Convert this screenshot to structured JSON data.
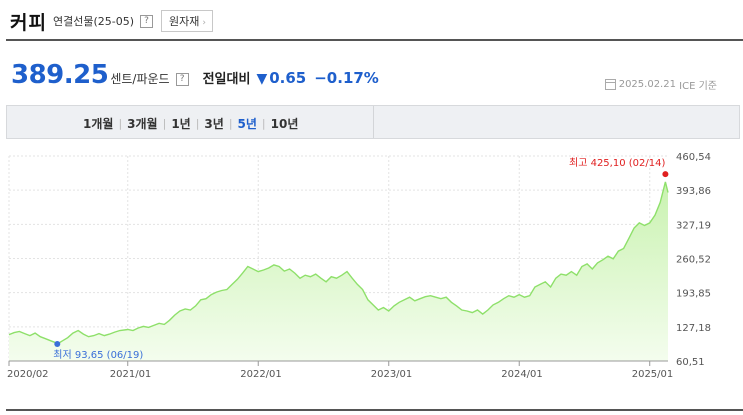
{
  "header": {
    "title": "커피",
    "subtitle": "연결선물(25-05)",
    "help": "?",
    "raw_button": "원자재",
    "raw_arrow": "›"
  },
  "quote": {
    "price": "389.25",
    "unit": "센트/파운드",
    "help": "?",
    "change_label": "전일대비",
    "change_arrow": "▼",
    "change_value": "0.65",
    "change_pct": "−0.17%",
    "date": "2025.02.21",
    "source": "ICE 기준"
  },
  "period_tabs": [
    {
      "label": "1개월",
      "active": false
    },
    {
      "label": "3개월",
      "active": false
    },
    {
      "label": "1년",
      "active": false
    },
    {
      "label": "3년",
      "active": false
    },
    {
      "label": "5년",
      "active": true
    },
    {
      "label": "10년",
      "active": false
    }
  ],
  "colors": {
    "price_blue": "#1e5fcc",
    "line_green": "#8ee06a",
    "fill_top": "#c9f2b0",
    "fill_bottom": "#f4fdee",
    "high_red": "#e02020",
    "low_blue": "#3a6fd8"
  },
  "chart_data": {
    "type": "area",
    "ylim": [
      60.51,
      460.54
    ],
    "y_ticks": [
      "460,54",
      "393,86",
      "327,19",
      "260,52",
      "193,85",
      "127,18",
      "60,51"
    ],
    "x_ticks": [
      "2020/02",
      "2021/01",
      "2022/01",
      "2023/01",
      "2024/01",
      "2025/01"
    ],
    "x_tick_dates": [
      2020.09,
      2021.0,
      2022.0,
      2023.0,
      2024.0,
      2025.0
    ],
    "x_range": [
      2020.09,
      2025.14
    ],
    "high": {
      "label": "최고 425,10 (02/14)",
      "date": 2025.12,
      "value": 425.1
    },
    "low": {
      "label": "최저 93,65 (06/19)",
      "date": 2020.46,
      "value": 93.65
    },
    "series": [
      {
        "points": [
          [
            2020.09,
            112
          ],
          [
            2020.13,
            116
          ],
          [
            2020.17,
            118
          ],
          [
            2020.21,
            114
          ],
          [
            2020.25,
            110
          ],
          [
            2020.29,
            115
          ],
          [
            2020.33,
            108
          ],
          [
            2020.37,
            104
          ],
          [
            2020.41,
            100
          ],
          [
            2020.44,
            97
          ],
          [
            2020.46,
            93.65
          ],
          [
            2020.5,
            100
          ],
          [
            2020.54,
            106
          ],
          [
            2020.58,
            115
          ],
          [
            2020.62,
            120
          ],
          [
            2020.66,
            113
          ],
          [
            2020.7,
            108
          ],
          [
            2020.74,
            110
          ],
          [
            2020.78,
            114
          ],
          [
            2020.82,
            110
          ],
          [
            2020.86,
            113
          ],
          [
            2020.9,
            117
          ],
          [
            2020.94,
            120
          ],
          [
            2021.0,
            122
          ],
          [
            2021.04,
            120
          ],
          [
            2021.08,
            125
          ],
          [
            2021.12,
            128
          ],
          [
            2021.16,
            126
          ],
          [
            2021.2,
            130
          ],
          [
            2021.24,
            134
          ],
          [
            2021.28,
            132
          ],
          [
            2021.32,
            140
          ],
          [
            2021.36,
            150
          ],
          [
            2021.4,
            158
          ],
          [
            2021.44,
            162
          ],
          [
            2021.48,
            160
          ],
          [
            2021.52,
            168
          ],
          [
            2021.56,
            180
          ],
          [
            2021.6,
            182
          ],
          [
            2021.64,
            190
          ],
          [
            2021.68,
            195
          ],
          [
            2021.72,
            198
          ],
          [
            2021.76,
            200
          ],
          [
            2021.8,
            210
          ],
          [
            2021.84,
            220
          ],
          [
            2021.88,
            232
          ],
          [
            2021.92,
            245
          ],
          [
            2021.96,
            240
          ],
          [
            2022.0,
            235
          ],
          [
            2022.04,
            238
          ],
          [
            2022.08,
            242
          ],
          [
            2022.12,
            248
          ],
          [
            2022.16,
            245
          ],
          [
            2022.2,
            236
          ],
          [
            2022.24,
            240
          ],
          [
            2022.28,
            232
          ],
          [
            2022.32,
            222
          ],
          [
            2022.36,
            228
          ],
          [
            2022.4,
            225
          ],
          [
            2022.44,
            230
          ],
          [
            2022.48,
            222
          ],
          [
            2022.52,
            215
          ],
          [
            2022.56,
            225
          ],
          [
            2022.6,
            222
          ],
          [
            2022.64,
            228
          ],
          [
            2022.68,
            235
          ],
          [
            2022.72,
            222
          ],
          [
            2022.76,
            210
          ],
          [
            2022.8,
            200
          ],
          [
            2022.84,
            180
          ],
          [
            2022.88,
            170
          ],
          [
            2022.92,
            160
          ],
          [
            2022.96,
            165
          ],
          [
            2023.0,
            158
          ],
          [
            2023.04,
            168
          ],
          [
            2023.08,
            175
          ],
          [
            2023.12,
            180
          ],
          [
            2023.16,
            185
          ],
          [
            2023.2,
            178
          ],
          [
            2023.24,
            182
          ],
          [
            2023.28,
            186
          ],
          [
            2023.32,
            188
          ],
          [
            2023.36,
            185
          ],
          [
            2023.4,
            182
          ],
          [
            2023.44,
            185
          ],
          [
            2023.48,
            175
          ],
          [
            2023.52,
            168
          ],
          [
            2023.56,
            160
          ],
          [
            2023.6,
            158
          ],
          [
            2023.64,
            155
          ],
          [
            2023.68,
            160
          ],
          [
            2023.72,
            152
          ],
          [
            2023.76,
            160
          ],
          [
            2023.8,
            170
          ],
          [
            2023.84,
            175
          ],
          [
            2023.88,
            182
          ],
          [
            2023.92,
            188
          ],
          [
            2023.96,
            185
          ],
          [
            2024.0,
            190
          ],
          [
            2024.04,
            185
          ],
          [
            2024.08,
            188
          ],
          [
            2024.12,
            205
          ],
          [
            2024.16,
            210
          ],
          [
            2024.2,
            215
          ],
          [
            2024.24,
            205
          ],
          [
            2024.28,
            222
          ],
          [
            2024.32,
            230
          ],
          [
            2024.36,
            228
          ],
          [
            2024.4,
            235
          ],
          [
            2024.44,
            228
          ],
          [
            2024.48,
            245
          ],
          [
            2024.52,
            250
          ],
          [
            2024.56,
            240
          ],
          [
            2024.6,
            252
          ],
          [
            2024.64,
            258
          ],
          [
            2024.68,
            265
          ],
          [
            2024.72,
            260
          ],
          [
            2024.76,
            275
          ],
          [
            2024.8,
            280
          ],
          [
            2024.84,
            300
          ],
          [
            2024.88,
            320
          ],
          [
            2024.92,
            330
          ],
          [
            2024.96,
            325
          ],
          [
            2025.0,
            330
          ],
          [
            2025.04,
            345
          ],
          [
            2025.08,
            370
          ],
          [
            2025.12,
            410
          ],
          [
            2025.14,
            389.25
          ]
        ]
      }
    ]
  }
}
